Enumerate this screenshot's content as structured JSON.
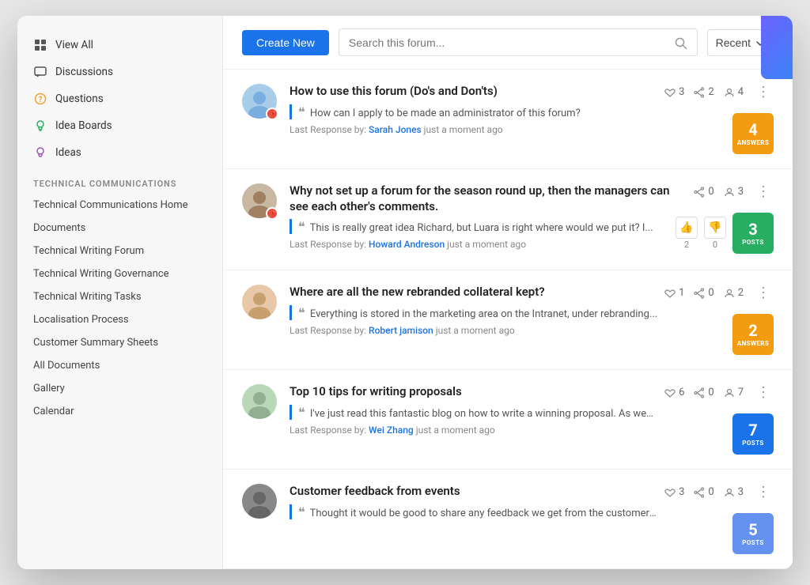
{
  "sidebar": {
    "view_all": "View All",
    "nav_items": [
      {
        "id": "discussions",
        "label": "Discussions",
        "icon": "chat"
      },
      {
        "id": "questions",
        "label": "Questions",
        "icon": "question"
      },
      {
        "id": "idea_boards",
        "label": "Idea Boards",
        "icon": "lightbulb"
      },
      {
        "id": "ideas",
        "label": "Ideas",
        "icon": "idea"
      }
    ],
    "section_title": "TECHNICAL COMMUNICATIONS",
    "sub_items": [
      "Technical Communications Home",
      "Documents",
      "Technical Writing Forum",
      "Technical Writing Governance",
      "Technical Writing Tasks",
      "Localisation Process",
      "Customer Summary Sheets",
      "All Documents",
      "Gallery",
      "Calendar"
    ]
  },
  "header": {
    "create_button": "Create New",
    "search_placeholder": "Search this forum...",
    "sort_label": "Recent"
  },
  "forum_posts": [
    {
      "id": 1,
      "title": "How to use this forum (Do's and Don'ts)",
      "preview": "How can I apply to be made an administrator of this forum?",
      "last_response_label": "Last Response by:",
      "last_response_user": "Sarah Jones",
      "last_response_time": "just a moment ago",
      "likes": 3,
      "shares": 2,
      "members": 4,
      "badge_count": 4,
      "badge_label": "ANSWERS",
      "badge_color": "orange",
      "avatar_color": "av-1",
      "has_pin": true
    },
    {
      "id": 2,
      "title": "Why not set up a forum for the season round up, then the managers can see each other's comments.",
      "preview": "This is really great idea Richard, but Luara is right where would we put it? I...",
      "last_response_label": "Last Response by:",
      "last_response_user": "Howard Andreson",
      "last_response_time": "just a moment ago",
      "shares": 0,
      "members": 3,
      "badge_count": 3,
      "badge_label": "POSTS",
      "badge_color": "green",
      "avatar_color": "av-2",
      "has_pin": true,
      "has_votes": true,
      "up_votes": 2,
      "down_votes": 0
    },
    {
      "id": 3,
      "title": "Where are all the new rebranded collateral kept?",
      "preview": "Everything is stored in the marketing area on the Intranet, under rebranding...",
      "last_response_label": "Last Response by:",
      "last_response_user": "Robert jamison",
      "last_response_time": "just a moment ago",
      "likes": 1,
      "shares": 0,
      "members": 2,
      "badge_count": 2,
      "badge_label": "ANSWERS",
      "badge_color": "orange",
      "avatar_color": "av-3",
      "has_pin": false
    },
    {
      "id": 4,
      "title": "Top 10 tips for writing proposals",
      "preview": "I've just read this fantastic blog on how to write a winning proposal. As we have so many tenders in at the moment, I thought it would be useful!",
      "last_response_label": "Last Response by:",
      "last_response_user": "Wei Zhang",
      "last_response_time": "just a moment ago",
      "likes": 6,
      "shares": 0,
      "members": 7,
      "badge_count": 7,
      "badge_label": "POSTS",
      "badge_color": "blue",
      "avatar_color": "av-4",
      "has_pin": false
    },
    {
      "id": 5,
      "title": "Customer feedback from events",
      "preview": "Thought it would be good to share any feedback we get from the customer events we run...",
      "last_response_label": "Last Response by:",
      "last_response_user": "",
      "last_response_time": "",
      "likes": 3,
      "shares": 0,
      "members": 3,
      "badge_count": 5,
      "badge_label": "POSTS",
      "badge_color": "darkblue",
      "avatar_color": "av-5",
      "has_pin": false,
      "partial": true
    }
  ]
}
